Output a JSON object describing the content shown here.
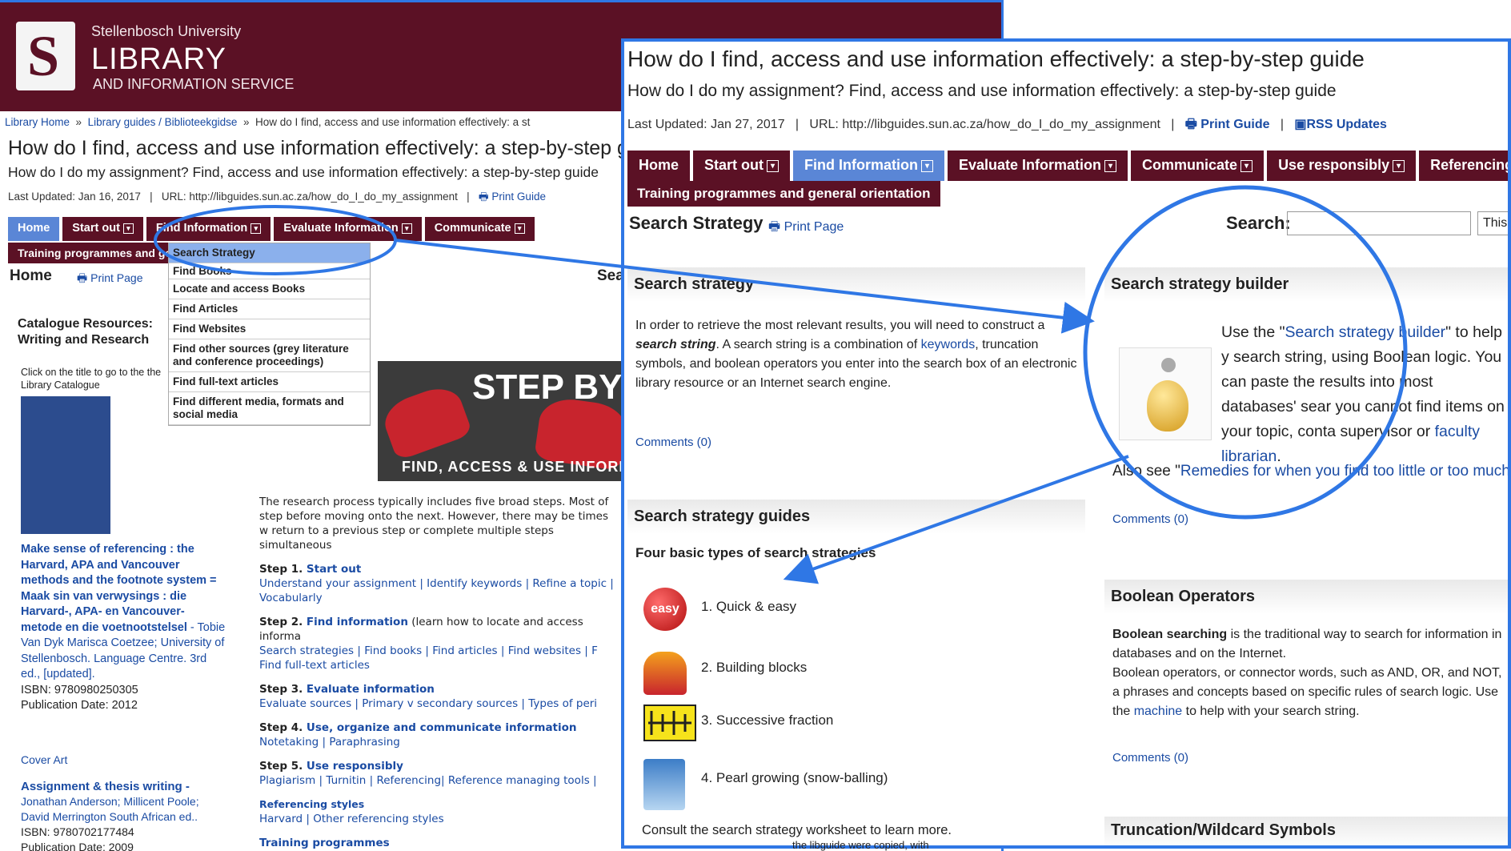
{
  "back": {
    "banner": {
      "university": "Stellenbosch University",
      "library": "LIBRARY",
      "service": "AND INFORMATION SERVICE"
    },
    "breadcrumb": {
      "home": "Library Home",
      "sep": "»",
      "guides": "Library guides / Biblioteekgidse",
      "current": "How do I find, access and use information effectively: a st"
    },
    "title": "How do I find, access and use information effectively: a step-by-step guide",
    "subtitle": "How do I do my assignment? Find, access and use information effectively: a step-by-step guide",
    "meta": {
      "updated": "Last Updated: Jan 16, 2017",
      "url": "URL: http://libguides.sun.ac.za/how_do_I_do_my_assignment",
      "print": "Print Guide"
    },
    "tabs": [
      "Home",
      "Start out",
      "Find Information",
      "Evaluate Information",
      "Communicate"
    ],
    "training": "Training programmes and general orientation",
    "home_heading": "Home",
    "print_page": "Print Page",
    "search_cut": "Sea",
    "dropdown": [
      "Search Strategy",
      "Find Books",
      "Locate and access Books",
      "Find Articles",
      "Find Websites",
      "Find other sources (grey literature and conference proceedings)",
      "Find full-text articles",
      "Find different media, formats and social media"
    ],
    "catalogue_heading": "Catalogue Resources: Writing and Research",
    "click_text": "Click on the title to go to the the Library Catalogue",
    "book1": {
      "title": "Make sense of referencing : the Harvard, APA and Vancouver methods and the footnote system = Maak sin van verwysings : die Harvard-, APA- en Vancouver-metode en die voetnootstelsel",
      "author": " - Tobie Van Dyk Marisca Coetzee; University of Stellenbosch. Language Centre. 3rd ed., [updated].",
      "isbn": "ISBN: 9780980250305",
      "date": "Publication Date: 2012"
    },
    "cover_art": "Cover Art",
    "book2": {
      "title": "Assignment & thesis writing -",
      "author": "Jonathan Anderson; Millicent Poole; David Merrington South African ed..",
      "isbn": "ISBN: 9780702177484",
      "date": "Publication Date: 2009"
    },
    "banner_image": {
      "headline": "STEP BY STEP",
      "caption": "FIND, ACCESS & USE INFORMATION"
    },
    "steps": {
      "intro": "The research process typically includes five broad steps. Most of step before moving onto the next. However, there may be times w return to a previous step or complete multiple steps simultaneous",
      "s1_label": "Step 1. ",
      "s1_link": "Start out",
      "s1_items": "Understand your assignment  |  Identify keywords  |  Refine a topic  |  Vocabularly",
      "s2_label": "Step 2. ",
      "s2_link": "Find information",
      "s2_note": " (learn how to locate and access informa",
      "s2_items": "Search strategies  |  Find books  |  Find articles  |  Find websites  |  F",
      "s2_items2": "Find full-text articles",
      "s3_label": "Step 3. ",
      "s3_link": "Evaluate information",
      "s3_items": "Evaluate sources  |  Primary v secondary sources  |  Types of peri",
      "s4_label": "Step 4. ",
      "s4_link": "Use, organize and communicate information",
      "s4_items": "Notetaking  |  Paraphrasing",
      "s5_label": "Step 5. ",
      "s5_link": "Use responsibly",
      "s5_items": "Plagiarism  |  Turnitin  |  Referencing|  Reference managing tools  |",
      "ref_styles": "Referencing styles",
      "ref_items": "Harvard  |  Other referencing styles",
      "training": "Training programmes"
    }
  },
  "front": {
    "title": "How do I find, access and use information effectively: a step-by-step guide",
    "subtitle": "How do I do my assignment? Find, access and use information effectively: a step-by-step guide",
    "meta": {
      "updated": "Last Updated: Jan 27, 2017",
      "url": "URL: http://libguides.sun.ac.za/how_do_I_do_my_assignment",
      "print": "Print Guide",
      "rss": "RSS Updates"
    },
    "tabs": [
      "Home",
      "Start out",
      "Find Information",
      "Evaluate Information",
      "Communicate",
      "Use responsibly",
      "Referencing"
    ],
    "training": "Training programmes and general orientation",
    "page_heading": "Search Strategy",
    "print_page": "Print Page",
    "search_label": "Search:",
    "search_scope": "This",
    "strategy_box": {
      "heading": "Search strategy",
      "p1": "In order to retrieve the most relevant results, you will need to construct a ",
      "p1_em": "search string",
      "p1b": ". A search string is a combination of ",
      "keywords": "keywords",
      "p1c": ", truncation symbols, and boolean operators you enter into the search box of an electronic library resource or an Internet search engine.",
      "comments": "Comments (0)"
    },
    "guides_box": {
      "heading": "Search strategy guides",
      "sub": "Four basic types of search strategies",
      "items": [
        "1. Quick & easy",
        "2. Building blocks",
        "3. Successive fraction",
        "4. Pearl growing (snow-balling)"
      ],
      "easy_badge": "easy",
      "footer": "Consult the search strategy worksheet to learn more."
    },
    "builder_box": {
      "heading": "Search strategy builder",
      "t1": "Use the \"",
      "link": "Search strategy builder",
      "t2": "\" to help y search string, using Boolean logic. You can paste the results into most databases' sear you cannot find items on your topic, conta supervisor or ",
      "faculty": "faculty librarian",
      "t3": ".",
      "also": "Also see \"",
      "remedies": "Remedies for when you find too little or too much info",
      "comments": "Comments (0)"
    },
    "boolean_box": {
      "heading": "Boolean Operators",
      "b": "Boolean searching",
      "t1": " is the traditional way to search for information in databases and on the Internet.",
      "t2": "Boolean operators, or connector words, such as AND, OR, and NOT, a phrases and concepts based on specific rules of search logic. Use the ",
      "machine": "machine",
      "t3": " to help with your search string.",
      "comments": "Comments (0)"
    },
    "truncation_heading": "Truncation/Wildcard Symbols",
    "bottom_cut": "the libguide were copied, with"
  },
  "colors": {
    "maroon": "#5b1125",
    "tab_active": "#5a86d6",
    "highlight": "#2f77e5",
    "link": "#1a4ba3"
  }
}
